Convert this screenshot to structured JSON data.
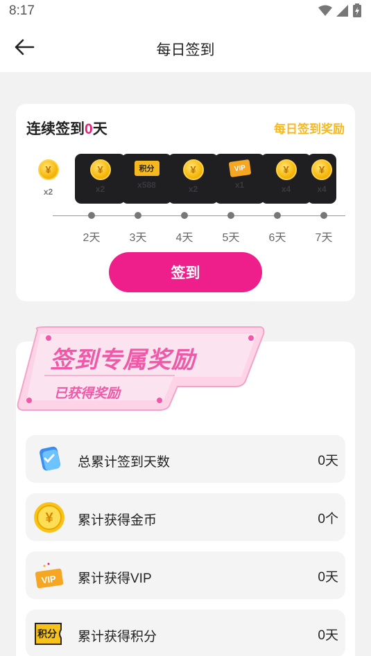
{
  "status_bar": {
    "time": "8:17"
  },
  "header": {
    "title": "每日签到"
  },
  "checkin": {
    "streak_prefix": "连续签到",
    "streak_count": "0",
    "streak_suffix": "天",
    "daily_rewards_link": "每日签到奖励",
    "days": [
      {
        "day_label": "",
        "reward_type": "coin",
        "amount": "x2",
        "is_today": true
      },
      {
        "day_label": "2天",
        "reward_type": "coin",
        "amount": "x2",
        "is_today": false
      },
      {
        "day_label": "3天",
        "reward_type": "points",
        "amount": "x588",
        "is_today": false
      },
      {
        "day_label": "4天",
        "reward_type": "coin",
        "amount": "x2",
        "is_today": false
      },
      {
        "day_label": "5天",
        "reward_type": "vip",
        "amount": "x1",
        "is_today": false
      },
      {
        "day_label": "6天",
        "reward_type": "coin",
        "amount": "x4",
        "is_today": false
      },
      {
        "day_label": "7天",
        "reward_type": "coin",
        "amount": "x4",
        "is_today": false
      }
    ],
    "coin_symbol": "¥",
    "points_icon_text": "积分",
    "vip_icon_text": "VIP",
    "button_label": "签到"
  },
  "rewards": {
    "banner_title": "签到专属奖励",
    "banner_subtitle": "已获得奖励",
    "stats": [
      {
        "icon": "calendar-check-icon",
        "label": "总累计签到天数",
        "value": "0天"
      },
      {
        "icon": "coin-icon",
        "label": "累计获得金币",
        "value": "0个"
      },
      {
        "icon": "vip-ticket-icon",
        "label": "累计获得VIP",
        "value": "0天"
      },
      {
        "icon": "points-ticket-icon",
        "label": "累计获得积分",
        "value": "0天"
      }
    ]
  },
  "colors": {
    "accent_pink": "#ee1f8a",
    "accent_gold": "#f5b91f"
  }
}
